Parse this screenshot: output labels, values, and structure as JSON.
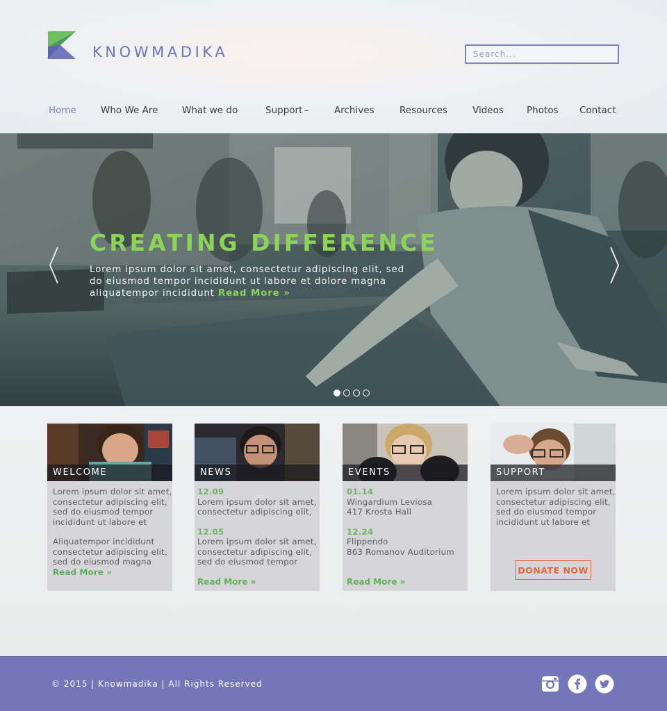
{
  "brand": {
    "name": "KNOWMADIKA"
  },
  "search": {
    "placeholder": "Search..."
  },
  "nav": {
    "items": [
      {
        "label": "Home"
      },
      {
        "label": "Who We Are"
      },
      {
        "label": "What we do"
      },
      {
        "label": "Support"
      },
      {
        "label": "Archives"
      },
      {
        "label": "Resources"
      },
      {
        "label": "Videos"
      },
      {
        "label": "Photos"
      },
      {
        "label": "Contact"
      }
    ],
    "active": "Home",
    "support_chevron": "⌣"
  },
  "hero": {
    "title": "CREATING DIFFERENCE",
    "body": "Lorem ipsum dolor sit amet, consectetur adipiscing elit, sed do eiusmod tempor incididunt ut labore et dolore magna aliquatempor incididunt",
    "read_more": "Read More »",
    "slides": 4,
    "current_slide": 1
  },
  "cards": {
    "welcome": {
      "label": "WELCOME",
      "p1": "Lorem ipsum dolor sit amet, consectetur adipiscing elit, sed do eiusmod tempor incididunt ut labore et",
      "p2": "Aliquatempor incididunt consectetur adipiscing elit, sed do eiusmod magna",
      "read_more": "Read More »"
    },
    "news": {
      "label": "NEWS",
      "items": [
        {
          "date": "12.09",
          "text": "Lorem ipsum dolor sit amet, consectetur adipiscing elit,"
        },
        {
          "date": "12.05",
          "text": "Lorem ipsum dolor sit amet, consectetur adipiscing elit, sed do eiusmod tempor"
        }
      ],
      "read_more": "Read More »"
    },
    "events": {
      "label": "EVENTS",
      "items": [
        {
          "date": "01.14",
          "line1": "Wingardium Leviosa",
          "line2": "417 Krosta Hall"
        },
        {
          "date": "12.24",
          "line1": "Flippendo",
          "line2": "863 Romanov Auditorium"
        }
      ],
      "read_more": "Read More »"
    },
    "support": {
      "label": "SUPPORT",
      "p1": "Lorem ipsum dolor sit amet, consectetur adipiscing elit, sed do eiusmod tempor incididunt ut labore et",
      "donate": "DONATE NOW"
    }
  },
  "footer": {
    "copyright": "© 2015 | Knowmadika | All Rights Reserved",
    "social": [
      "instagram-icon",
      "facebook-icon",
      "twitter-icon"
    ]
  },
  "colors": {
    "accent": "#7377b9",
    "green": "#8bd35a",
    "donate": "#e2653e",
    "card_bg": "#d6d6da"
  }
}
